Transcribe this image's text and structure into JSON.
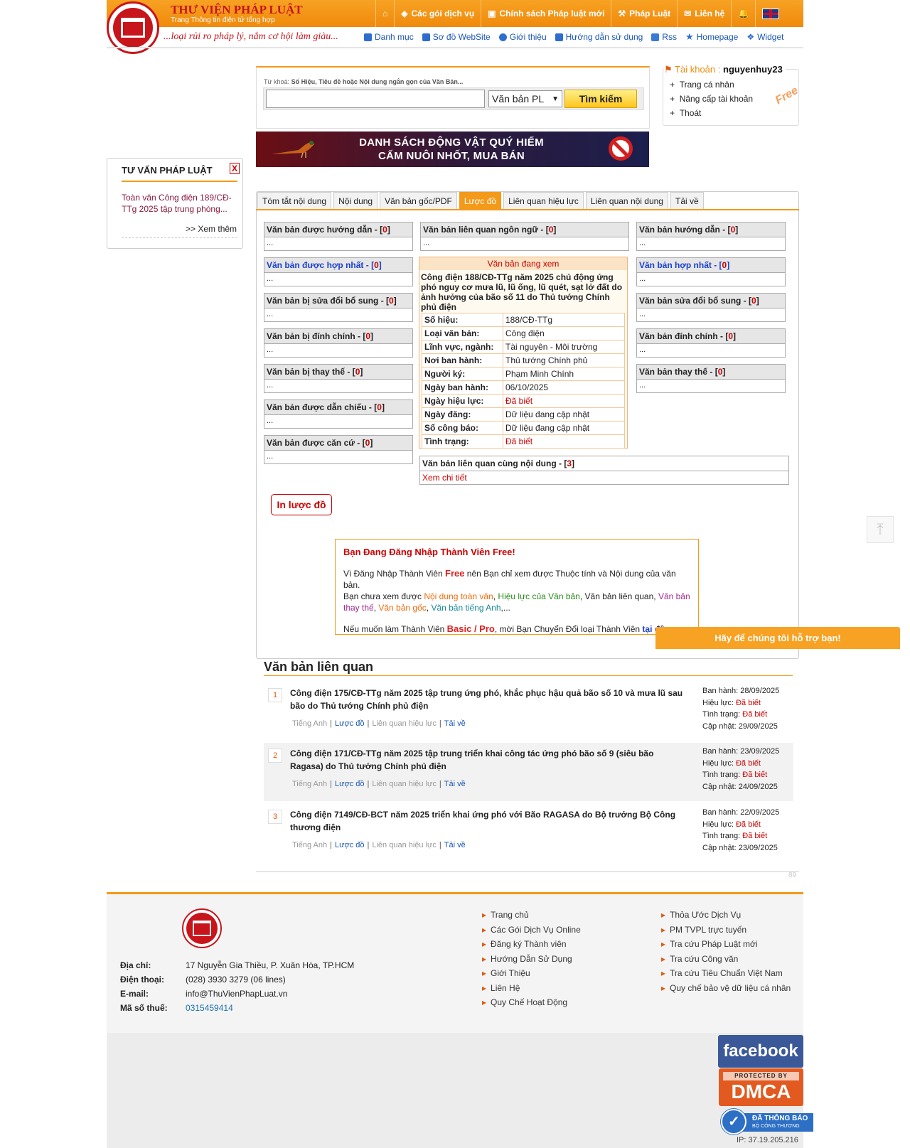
{
  "header": {
    "brand": "THƯ VIỆN PHÁP LUẬT",
    "brand_sub": "Trang Thông tin điện tử tổng hợp",
    "slogan": "...loại rủi ro pháp lý, nắm cơ hội làm giàu...",
    "topnav": [
      "Các gói dịch vụ",
      "Chính sách Pháp luật mới",
      "Pháp Luật",
      "Liên hệ"
    ],
    "subnav": [
      "Danh mục",
      "Sơ đồ WebSite",
      "Giới thiệu",
      "Hướng dẫn sử dụng",
      "Rss",
      "Homepage",
      "Widget"
    ]
  },
  "search": {
    "hint_prefix": "Từ khoá:",
    "hint": "Số Hiệu, Tiêu đề hoặc Nội dung ngắn gọn của Văn Bản...",
    "value": "",
    "select_value": "Văn bản PL",
    "button": "Tìm kiếm"
  },
  "account": {
    "label": "Tài khoản :",
    "username": "nguyenhuy23",
    "items": [
      "Trang cá nhân",
      "Nâng cấp tài khoản",
      "Thoát"
    ],
    "badge": "Free"
  },
  "banner": {
    "line1": "DANH SÁCH ĐỘNG VẬT QUÝ HIẾM",
    "line2": "CẤM NUÔI NHỐT, MUA BÁN"
  },
  "advice": {
    "title": "TƯ VẤN PHÁP LUẬT",
    "close": "X",
    "link": "Toàn văn Công điện 189/CĐ-TTg 2025 tập trung phòng...",
    "more": ">> Xem thêm"
  },
  "tabs": [
    "Tóm tắt nội dung",
    "Nội dung",
    "Văn bản gốc/PDF",
    "Lược đồ",
    "Liên quan hiệu lực",
    "Liên quan nội dung",
    "Tải về"
  ],
  "active_tab": "Lược đồ",
  "left_boxes": [
    {
      "label": "Văn bản được hướng dẫn",
      "count": "0",
      "body": "..."
    },
    {
      "label": "Văn bản được hợp nhất",
      "count": "0",
      "body": "..."
    },
    {
      "label": "Văn bản bị sửa đổi bổ sung",
      "count": "0",
      "body": "..."
    },
    {
      "label": "Văn bản bị đính chính",
      "count": "0",
      "body": "..."
    },
    {
      "label": "Văn bản bị thay thế",
      "count": "0",
      "body": "..."
    },
    {
      "label": "Văn bản được dẫn chiếu",
      "count": "0",
      "body": "..."
    },
    {
      "label": "Văn bản được căn cứ",
      "count": "0",
      "body": "..."
    }
  ],
  "center_top": {
    "label": "Văn bản liên quan ngôn ngữ",
    "count": "0",
    "body": "..."
  },
  "right_boxes": [
    {
      "label": "Văn bản hướng dẫn",
      "count": "0",
      "body": "..."
    },
    {
      "label": "Văn bản hợp nhất",
      "count": "0",
      "body": "..."
    },
    {
      "label": "Văn bản sửa đổi bổ sung",
      "count": "0",
      "body": "..."
    },
    {
      "label": "Văn bản đính chính",
      "count": "0",
      "body": "..."
    },
    {
      "label": "Văn bản thay thế",
      "count": "0",
      "body": "..."
    }
  ],
  "current": {
    "heading": "Văn bản đang xem",
    "title": "Công điện 188/CĐ-TTg năm 2025 chủ động ứng phó nguy cơ mưa lũ, lũ ống, lũ quét, sạt lở đất do ảnh hưởng của bão số 11 do Thủ tướng Chính phủ điện",
    "rows": [
      {
        "k": "Số hiệu:",
        "v": "188/CĐ-TTg"
      },
      {
        "k": "Loại văn bản:",
        "v": "Công điện"
      },
      {
        "k": "Lĩnh vực, ngành:",
        "v": "Tài nguyên - Môi trường"
      },
      {
        "k": "Nơi ban hành:",
        "v": "Thủ tướng Chính phủ"
      },
      {
        "k": "Người ký:",
        "v": "Phạm Minh Chính"
      },
      {
        "k": "Ngày ban hành:",
        "v": "06/10/2025"
      },
      {
        "k": "Ngày hiệu lực:",
        "v": "Đã biết"
      },
      {
        "k": "Ngày đăng:",
        "v": "Dữ liệu đang cập nhật"
      },
      {
        "k": "Số công báo:",
        "v": "Dữ liệu đang cập nhật"
      },
      {
        "k": "Tình trạng:",
        "v": "Đã biết"
      }
    ]
  },
  "same_content": {
    "label": "Văn bản liên quan cùng nội dung",
    "count": "3",
    "link": "Xem chi tiết"
  },
  "print_button": "In lược đồ",
  "notice": {
    "title": "Bạn Đang Đăng Nhập Thành Viên Free!",
    "p1_a": "Vì Đăng Nhập Thành Viên ",
    "p1_free": "Free",
    "p1_b": " nên Bạn chỉ xem được Thuộc tính và Nội dung của văn bản.",
    "p2_a": "Bạn chưa xem được ",
    "p2_noidung": "Nội dung toàn văn",
    "p2_hieuluc": "Hiệu lực của Văn bản",
    "p2_lienquan": "Văn bản liên quan",
    "p2_thaythe": "Văn bản thay thế",
    "p2_goc": "Văn bản gốc",
    "p2_anh": "Văn bản tiếng Anh",
    "p2_end": ",...",
    "p3_a": "Nếu muốn làm Thành Viên ",
    "p3_plan": "Basic / Pro",
    "p3_b": ", mời Bạn Chuyển Đổi loại Thành Viên ",
    "p3_link": "tại đây."
  },
  "help_bar": "Hãy để chúng tôi hỗ trợ bạn!",
  "related": {
    "title": "Văn bản liên quan",
    "items": [
      {
        "num": "1",
        "name": "Công điện 175/CĐ-TTg năm 2025 tập trung ứng phó, khắc phục hậu quả bão số 10 và mưa lũ sau bão do Thủ tướng Chính phủ điện",
        "issued": "28/09/2025",
        "effect": "Đã biết",
        "status": "Đã biết",
        "updated": "29/09/2025"
      },
      {
        "num": "2",
        "name": "Công điện 171/CĐ-TTg năm 2025 tập trung triển khai công tác ứng phó bão số 9 (siêu bão Ragasa) do Thủ tướng Chính phủ điện",
        "issued": "23/09/2025",
        "effect": "Đã biết",
        "status": "Đã biết",
        "updated": "24/09/2025"
      },
      {
        "num": "3",
        "name": "Công điện 7149/CĐ-BCT năm 2025 triển khai ứng phó với Bão RAGASA do Bộ trưởng Bộ Công thương điện",
        "issued": "22/09/2025",
        "effect": "Đã biết",
        "status": "Đã biết",
        "updated": "23/09/2025"
      }
    ],
    "links": [
      "Tiếng Anh",
      "Lược đồ",
      "Liên quan hiệu lực",
      "Tải về"
    ],
    "meta_labels": [
      "Ban hành:",
      "Hiệu lực:",
      "Tình trạng:",
      "Cập nhật:"
    ],
    "page_number": "89"
  },
  "footer": {
    "address_k": "Địa chỉ:",
    "address_v": "17 Nguyễn Gia Thiều, P. Xuân Hòa, TP.HCM",
    "phone_k": "Điện thoại:",
    "phone_v": "(028) 3930 3279 (06 lines)",
    "email_k": "E-mail:",
    "email_v": "info@ThuVienPhapLuat.vn",
    "tax_k": "Mã số thuế:",
    "tax_v": "0315459414",
    "col1": [
      "Trang chủ",
      "Các Gói Dịch Vụ Online",
      "Đăng ký Thành viên",
      "Hướng Dẫn Sử Dụng",
      "Giới Thiệu",
      "Liên Hệ",
      "Quy Chế Hoạt Động"
    ],
    "col2": [
      "Thỏa Ước Dịch Vụ",
      "PM TVPL trực tuyến",
      "Tra cứu Pháp Luật mới",
      "Tra cứu Công văn",
      "Tra cứu Tiêu Chuẩn Việt Nam",
      "Quy chế bảo vệ dữ liệu cá nhân"
    ],
    "facebook": "facebook",
    "dmca_top": "PROTECTED BY",
    "dmca": "DMCA",
    "bct": "ĐÃ THÔNG BÁO",
    "bct_sub": "BỘ CÔNG THƯƠNG",
    "ip": "IP: 37.19.205.216"
  }
}
